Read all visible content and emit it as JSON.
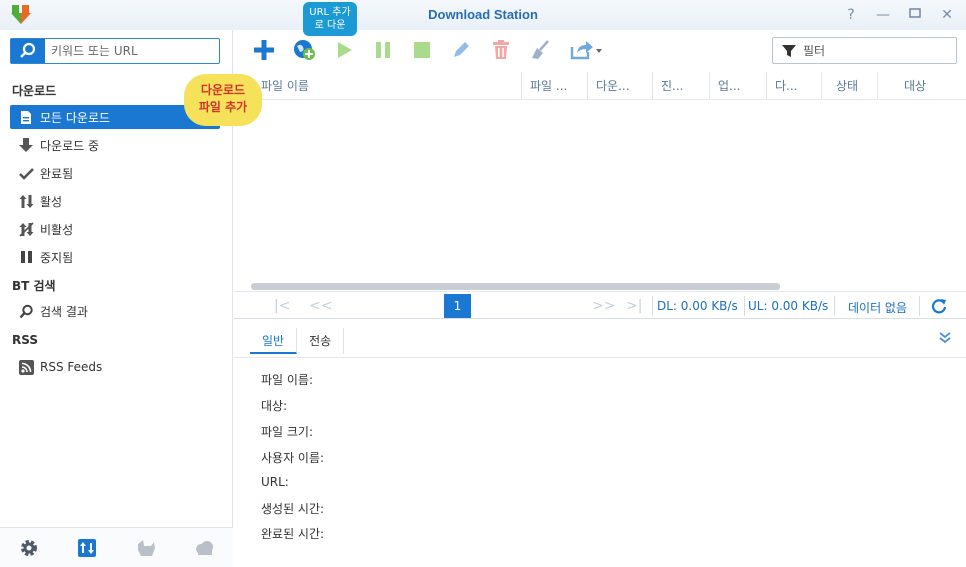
{
  "window": {
    "title": "Download Station"
  },
  "search": {
    "placeholder": "키워드 또는 URL"
  },
  "filter": {
    "placeholder": "필터"
  },
  "sidebar": {
    "sections": {
      "download": "다운로드",
      "bt": "BT 검색",
      "rss": "RSS"
    },
    "items": {
      "all": "모든 다운로드",
      "downloading": "다운로드 중",
      "completed": "완료됨",
      "active": "활성",
      "inactive": "비활성",
      "stopped": "중지됨",
      "search_results": "검색 결과",
      "rss_feeds": "RSS Feeds"
    }
  },
  "grid": {
    "columns": [
      "파일 이름",
      "파일 ...",
      "다운...",
      "진...",
      "업...",
      "다...",
      "상태",
      "대상"
    ]
  },
  "pager": {
    "page": "1",
    "dl": "DL: 0.00 KB/s",
    "ul": "UL: 0.00 KB/s",
    "empty": "데이터 없음"
  },
  "details": {
    "tabs": [
      "일반",
      "전송"
    ],
    "fields": [
      "파일 이름:",
      "대상:",
      "파일 크기:",
      "사용자 이름:",
      "URL:",
      "생성된 시간:",
      "완료된 시간:"
    ]
  },
  "callouts": {
    "add_file_line1": "다운로드",
    "add_file_line2": "파일 추가",
    "add_url_line1": "URL 추가",
    "add_url_line2": "로 다운"
  },
  "colors": {
    "accent": "#1a78d3",
    "title": "#2a6db3",
    "play": "#6cc04a",
    "delete": "#e9706a",
    "callout_yellow": "#f5e25a",
    "callout_blue": "#1c9ad6"
  }
}
